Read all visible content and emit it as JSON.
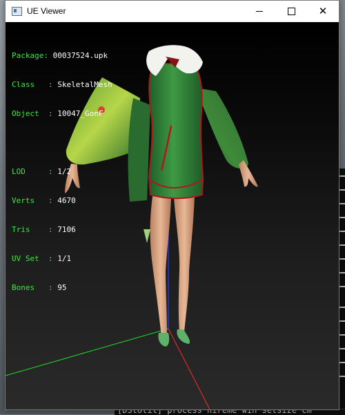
{
  "window": {
    "title": "UE Viewer",
    "controls": {
      "minimize": "minimize",
      "maximize": "maximize",
      "close": "✕"
    }
  },
  "info": {
    "package": {
      "label": "Package: ",
      "value": "00037524.upk"
    },
    "class": {
      "label": "Class   : ",
      "value": "SkeletalMesh"
    },
    "object": {
      "label": "Object  : ",
      "value": "10047_GonF"
    },
    "lod": {
      "label": "LOD     : ",
      "value": "1/2"
    },
    "verts": {
      "label": "Verts   : ",
      "value": "4670"
    },
    "tris": {
      "label": "Tris    : ",
      "value": "7106"
    },
    "uvset": {
      "label": "UV Set  : ",
      "value": "1/1"
    },
    "bones": {
      "label": "Bones   : ",
      "value": "95"
    }
  },
  "background_console": {
    "bottom_text": "[DStotil] process  nireme win setsize  cm"
  },
  "colors": {
    "info_label": "#3ee63e",
    "info_value": "#ffffff",
    "axis_x": "#ff2a2a",
    "axis_y": "#22dd22",
    "axis_z": "#2a3cff",
    "dress_green": "#2f8a3a",
    "trim_red": "#b01818",
    "fur_white": "#f2f2ee",
    "skin": "#d9a684"
  }
}
